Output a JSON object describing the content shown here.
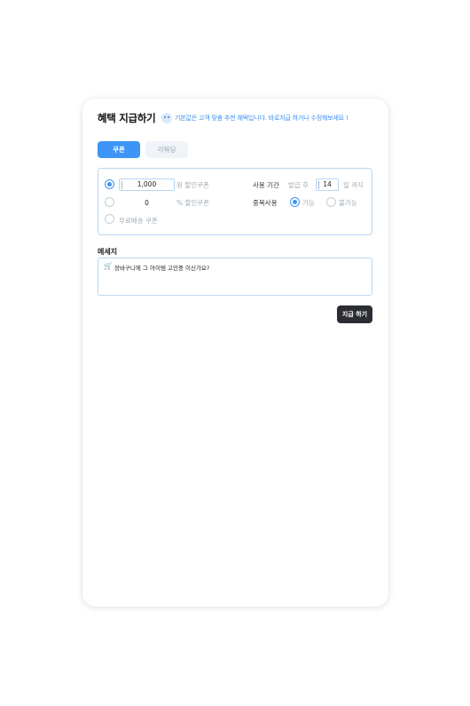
{
  "header": {
    "title": "혜택 지급하기",
    "hint": "기본값은 고객 맞춤 추천 혜택입니다. 바로지급 하거나 수정해보세요 !"
  },
  "tabs": [
    {
      "label": "쿠폰",
      "active": true
    },
    {
      "label": "리워딩",
      "active": false
    }
  ],
  "coupon": {
    "options": [
      {
        "value": "1,000",
        "unit": "원 할인쿠폰",
        "selected": true
      },
      {
        "value": "0",
        "unit": "% 할인쿠폰",
        "selected": false
      },
      {
        "label": "무료배송 쿠폰",
        "selected": false
      }
    ],
    "period": {
      "label": "사용 기간",
      "prefix": "발급 후",
      "value": "14",
      "suffix": "일 까지"
    },
    "duplicate": {
      "label": "중복사용",
      "options": [
        {
          "label": "가능",
          "selected": true
        },
        {
          "label": "불가능",
          "selected": false
        }
      ]
    }
  },
  "message": {
    "label": "메세지",
    "icon": "cart-icon",
    "text": "장바구니에 그 아이템 고민중 이신가요?"
  },
  "submit_label": "지급 하기",
  "colors": {
    "accent": "#3d95f5",
    "border": "#b9d6f2",
    "button_dark": "#2b2d33"
  }
}
